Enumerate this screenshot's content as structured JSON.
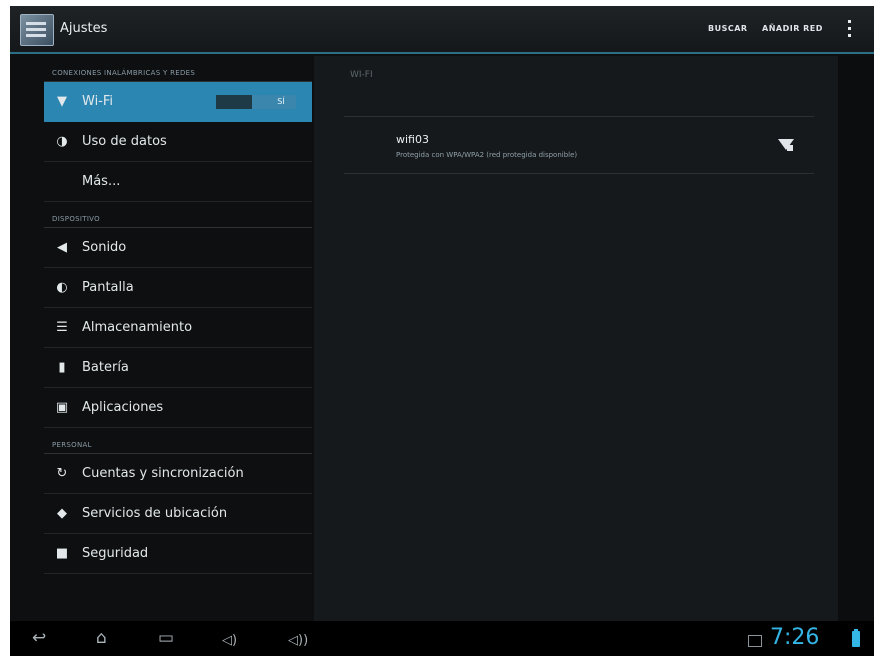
{
  "action_bar": {
    "title": "Ajustes",
    "search_label": "BUSCAR",
    "add_label": "AÑADIR RED"
  },
  "sidebar": {
    "sections": {
      "wireless": "CONEXIONES INALÁMBRICAS Y REDES",
      "device": "DISPOSITIVO",
      "personal": "PERSONAL"
    },
    "items": {
      "wifi": "Wi-Fi",
      "data_usage": "Uso de datos",
      "more": "Más...",
      "sound": "Sonido",
      "display": "Pantalla",
      "storage": "Almacenamiento",
      "battery": "Batería",
      "apps": "Aplicaciones",
      "accounts": "Cuentas y sincronización",
      "location": "Servicios de ubicación",
      "security": "Seguridad"
    },
    "wifi_toggle": "SÍ"
  },
  "wifi_panel": {
    "header": "WI-FI",
    "networks": [
      {
        "name": "wifi03",
        "status": "Protegida con WPA/WPA2 (red protegida disponible)"
      }
    ]
  },
  "status_bar": {
    "time": "7:26"
  },
  "colors": {
    "accent": "#2b86b2",
    "clock": "#33b5e5"
  }
}
